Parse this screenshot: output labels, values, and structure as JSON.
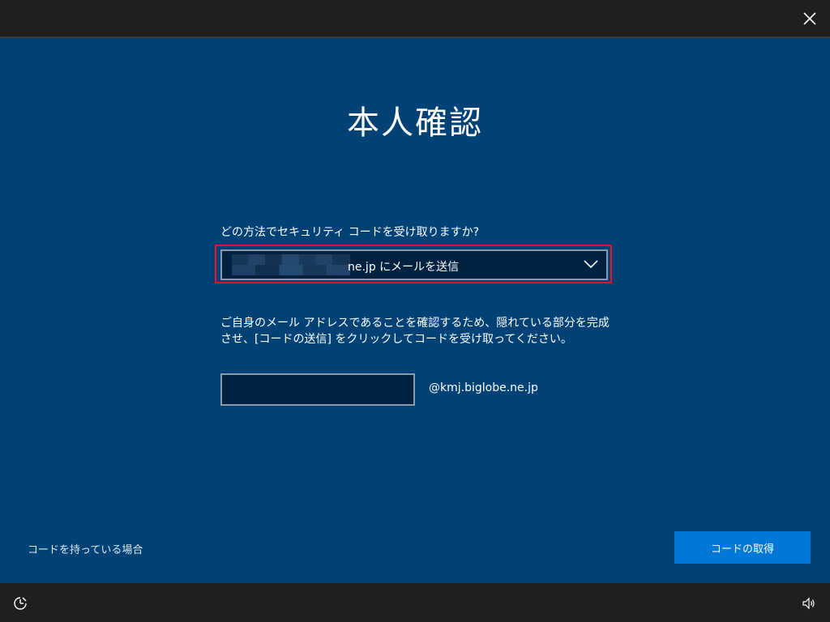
{
  "title": "本人確認",
  "question": "どの方法でセキュリティ コードを受け取りますか?",
  "method_select": {
    "selected_value": "ne.jp にメールを送信"
  },
  "description": "ご自身のメール アドレスであることを確認するため、隠れている部分を完成させ、[コードの送信] をクリックしてコードを受け取ってください。",
  "email_input": {
    "value": "",
    "domain_suffix": "@kmj.biglobe.ne.jp"
  },
  "have_code_link": "コードを持っている場合",
  "get_code_button": "コードの取得",
  "icons": {
    "close": "close-icon",
    "chevron": "chevron-down-icon",
    "ease_of_access": "ease-of-access-icon",
    "volume": "volume-icon"
  },
  "colors": {
    "background": "#004275",
    "bar": "#1f1f1f",
    "field": "#00213f",
    "accent": "#0078d7",
    "highlight": "#e81123"
  }
}
